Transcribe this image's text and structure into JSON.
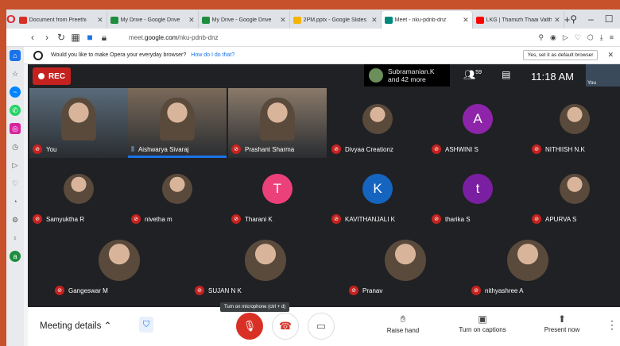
{
  "browser": {
    "tabs": [
      {
        "title": "Document from Preethi",
        "fav_color": "#d93025",
        "active": false
      },
      {
        "title": "My Drive - Google Drive",
        "fav_color": "#1e8e3e",
        "active": false
      },
      {
        "title": "My Drive - Google Drive",
        "fav_color": "#1e8e3e",
        "active": false
      },
      {
        "title": "2PM.pptx - Google Slides",
        "fav_color": "#f4b400",
        "active": false
      },
      {
        "title": "Meet - nku-pdnb-dnz",
        "fav_color": "#00897b",
        "active": true
      },
      {
        "title": "LKG | Thamizh Thaai Valth",
        "fav_color": "#ff0000",
        "active": false
      }
    ],
    "url_prefix": "meet.",
    "url_domain": "google.com",
    "url_path": "/nku-pdnb-dnz",
    "infobar": {
      "text": "Would you like to make Opera your everyday browser?",
      "link": "How do I do that?",
      "button": "Yes, set it as default browser"
    }
  },
  "meet": {
    "rec_label": "REC",
    "presenter": {
      "name": "Subramanian.K",
      "more": "and 42 more"
    },
    "people_count": "59",
    "clock": "11:18 AM",
    "self_label": "You",
    "participants": [
      {
        "name": "You",
        "type": "video",
        "color": "#5a6b7a"
      },
      {
        "name": "Aishwarya Sivaraj",
        "type": "video",
        "color": "#7a6a5a",
        "speaking": true
      },
      {
        "name": "Prashant Sharma",
        "type": "video",
        "color": "#8a7a6a"
      },
      {
        "name": "Divyaa Creationz",
        "type": "photo"
      },
      {
        "name": "ASHWINI S",
        "type": "letter",
        "letter": "A",
        "color": "#8e24aa"
      },
      {
        "name": "NITHIISH N.K",
        "type": "photo"
      },
      {
        "name": "Samyuktha R",
        "type": "photo"
      },
      {
        "name": "nivetha m",
        "type": "photo"
      },
      {
        "name": "Tharani K",
        "type": "letter",
        "letter": "T",
        "color": "#ec407a"
      },
      {
        "name": "KAVITHANJALI K",
        "type": "letter",
        "letter": "K",
        "color": "#1565c0"
      },
      {
        "name": "tharika S",
        "type": "letter",
        "letter": "t",
        "color": "#7b1fa2"
      },
      {
        "name": "APURVA S",
        "type": "photo"
      },
      {
        "name": "Gangeswar M",
        "type": "photo"
      },
      {
        "name": "SUJAN N K",
        "type": "photo"
      },
      {
        "name": "Pranav",
        "type": "photo"
      },
      {
        "name": "nithyashree A",
        "type": "photo"
      }
    ],
    "tooltip": "Turn on microphone (ctrl + d)",
    "bottom": {
      "meeting_details": "Meeting details",
      "raise_hand": "Raise hand",
      "captions": "Turn on captions",
      "present": "Present now"
    }
  }
}
